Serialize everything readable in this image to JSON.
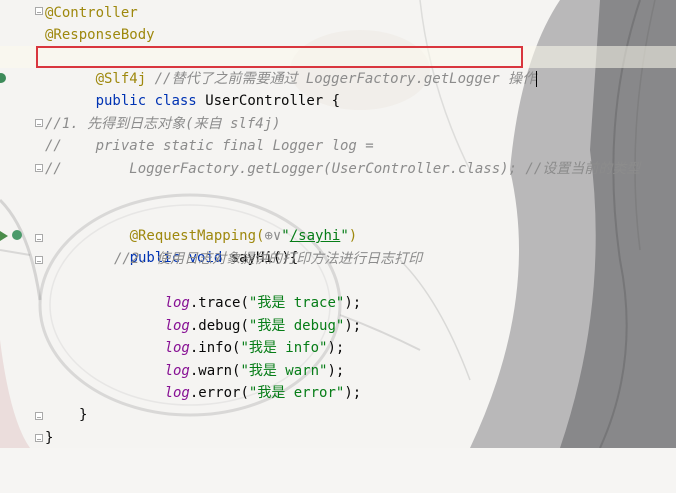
{
  "editor": {
    "lines": {
      "l1": {
        "text": "@Controller"
      },
      "l2": {
        "text": "@ResponseBody"
      },
      "l3": {
        "ann": "@Slf4j",
        "comment": " //替代了之前需要通过 LoggerFactory.getLogger 操作"
      },
      "l4": {
        "kw1": "public",
        "kw2": "class",
        "name": "UserController {"
      },
      "l5": {
        "text": ""
      },
      "l6": {
        "comment": "//1. 先得到日志对象(来自 slf4j)"
      },
      "l7": {
        "comment": "//    private static final Logger log ="
      },
      "l8": {
        "comment": "//        LoggerFactory.getLogger(UserController.class); //设置当前的类型"
      },
      "l9": {
        "text": ""
      },
      "l10": {
        "ann": "@RequestMapping(",
        "globe": "⊕∨",
        "quote1": "\"",
        "url": "/sayhi",
        "quote2": "\"",
        "close": ")"
      },
      "l11": {
        "kw1": "public",
        "kw2": "void",
        "rest": "sayHi(){"
      },
      "l12": {
        "comment": "//2. 使用日志对象提供的打印方法进行日志打印"
      },
      "l13": {
        "field": "log",
        "call": ".trace(",
        "arg": "\"我是 trace\"",
        "end": ");"
      },
      "l14": {
        "field": "log",
        "call": ".debug(",
        "arg": "\"我是 debug\"",
        "end": ");"
      },
      "l15": {
        "field": "log",
        "call": ".info(",
        "arg": "\"我是 info\"",
        "end": ");"
      },
      "l16": {
        "field": "log",
        "call": ".warn(",
        "arg": "\"我是 warn\"",
        "end": ");"
      },
      "l17": {
        "field": "log",
        "call": ".error(",
        "arg": "\"我是 error\"",
        "end": ");"
      },
      "l18": {
        "text": ""
      },
      "l19": {
        "text": "}"
      },
      "l20": {
        "text": "}"
      }
    },
    "icons": {
      "bean": "bean-icon",
      "run": "run-gutter-icon",
      "endpoint": "web-endpoint-icon",
      "fold": "fold-marker-icon"
    },
    "colors": {
      "annotation": "#9e880d",
      "keyword": "#0033b3",
      "comment": "#8c8c8c",
      "string": "#067d17",
      "field": "#871094",
      "highlight_box": "#d9363e"
    }
  }
}
